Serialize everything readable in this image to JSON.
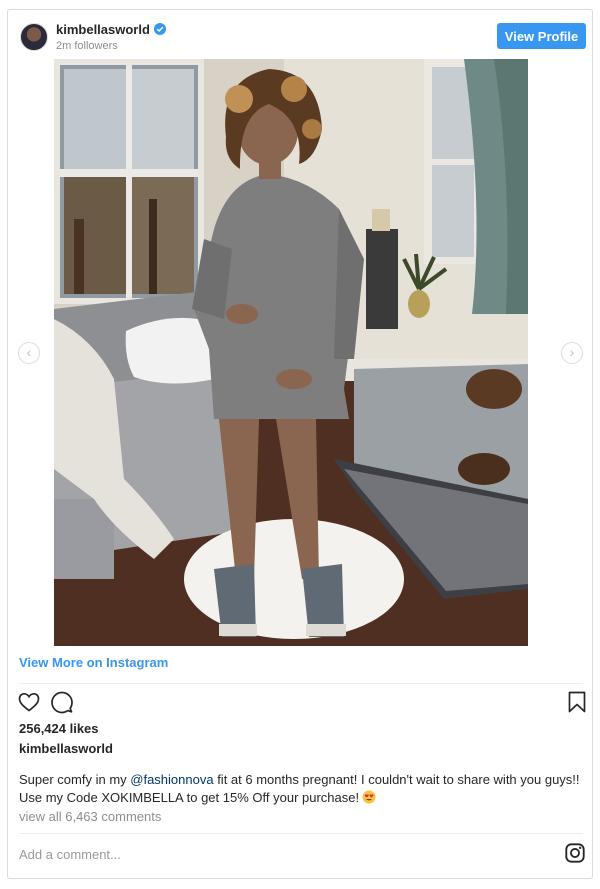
{
  "header": {
    "username": "kimbellasworld",
    "followers": "2m followers",
    "view_profile_label": "View Profile"
  },
  "post": {
    "view_more_label": "View More on Instagram",
    "likes": "256,424 likes",
    "author": "kimbellasworld",
    "caption_part1": "Super comfy in my ",
    "caption_mention": "@fashionnova",
    "caption_part2": " fit at 6 months pregnant! I couldn't wait to share with you guys!! Use my Code XOKIMBELLA to get 15% Off your purchase!",
    "view_comments": "view all 6,463 comments",
    "comment_placeholder": "Add a comment..."
  },
  "icons": {
    "like": "heart-icon",
    "comment": "speech-bubble-icon",
    "save": "bookmark-icon",
    "brand": "instagram-icon",
    "verified": "verified-badge-icon",
    "emoji": "heart-eyes-emoji-icon",
    "prev": "chevron-left-icon",
    "next": "chevron-right-icon"
  },
  "colors": {
    "accent": "#3897f0",
    "text": "#262626",
    "muted": "#8e8e8e",
    "border": "#dbdbdb",
    "mention": "#003569"
  }
}
